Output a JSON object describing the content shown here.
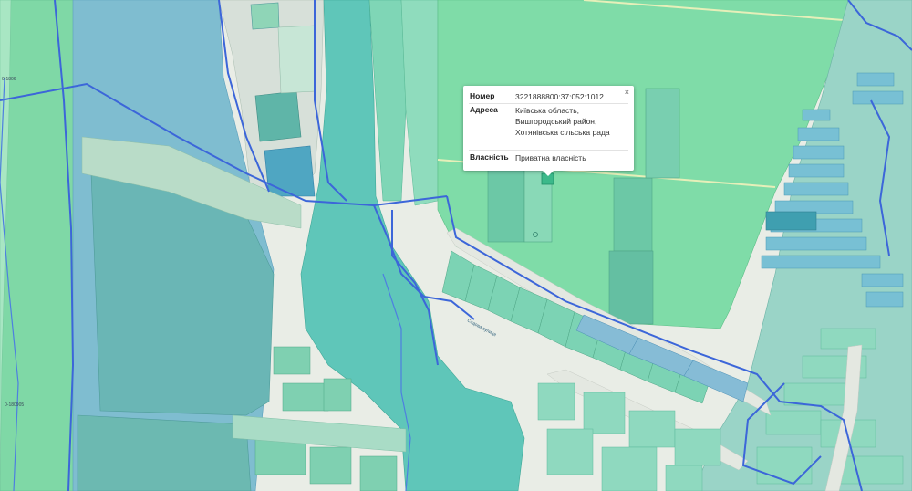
{
  "popup": {
    "number_label": "Номер",
    "number_value": "3221888800:37:052:1012",
    "address_label": "Адреса",
    "address_value": "Київська область, Вишгородський район, Хотянівська сільська рада",
    "ownership_label": "Власність",
    "ownership_value": "Приватна власність",
    "close_symbol": "×"
  },
  "map_labels": {
    "left_code_top": "0-1806",
    "left_code_bottom": "0-180905",
    "river_street": "Садова вулиця"
  },
  "colors": {
    "parcel_green": "#8fdcb3",
    "parcel_teal": "#74cdb8",
    "water": "#60c7bb",
    "parcel_blue": "#8ab9d6",
    "boundary_blue": "#3c66d9",
    "road": "#e4e8e1"
  }
}
